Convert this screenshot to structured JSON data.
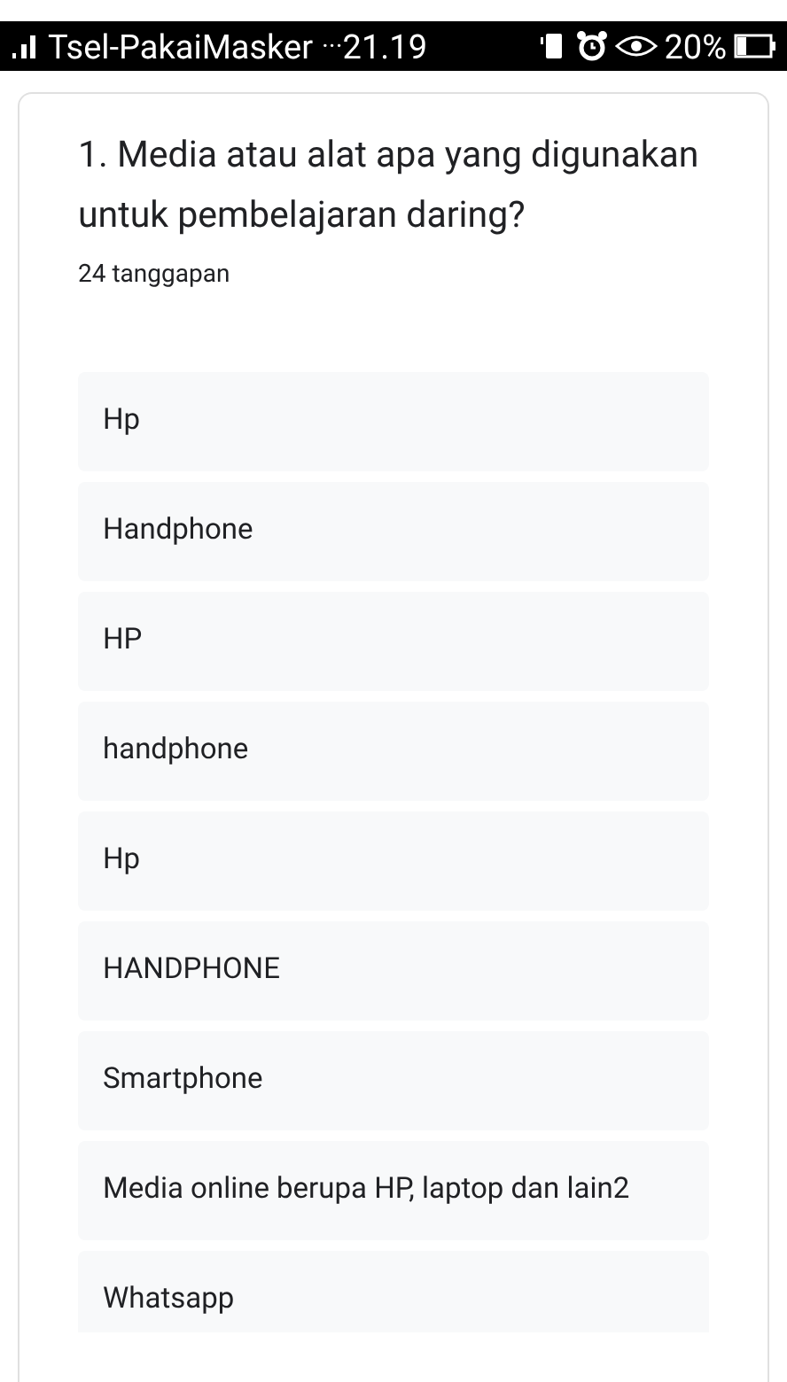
{
  "status_bar": {
    "carrier": "Tsel-PakaiMasker",
    "dots": "···",
    "time": "21.19",
    "battery_percent": "20%"
  },
  "question": {
    "title": "1. Media atau alat apa yang digunakan untuk pembelajaran daring?",
    "count": "24 tanggapan"
  },
  "responses": [
    "Hp",
    "Handphone",
    "HP",
    "handphone",
    "Hp",
    "HANDPHONE",
    "Smartphone",
    "Media online berupa HP, laptop dan lain2",
    "Whatsapp"
  ]
}
